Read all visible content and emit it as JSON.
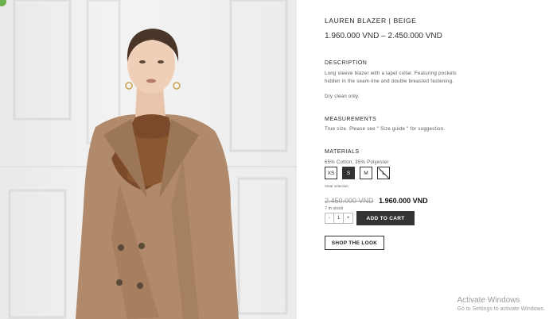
{
  "product": {
    "title": "LAUREN BLAZER | BEIGE",
    "price_range": "1.960.000 VND – 2.450.000 VND"
  },
  "description": {
    "heading": "DESCRIPTION",
    "line1": "Long sleeve blazer with a lapel collar. Featuring pockets",
    "line2": "hidden in the seam-line and double breasted fastening.",
    "care": "Dry clean only."
  },
  "measurements": {
    "heading": "MEASUREMENTS",
    "text": "True size. Please see \" Size guide \" for suggestion."
  },
  "materials": {
    "heading": "MATERIALS",
    "text": "65% Cotton, 35% Polyester"
  },
  "sizes": [
    {
      "label": "XS",
      "state": "available"
    },
    {
      "label": "S",
      "state": "selected"
    },
    {
      "label": "M",
      "state": "available"
    },
    {
      "label": "L",
      "state": "unavailable"
    }
  ],
  "clear_selection": "Clear selection",
  "pricing": {
    "old_price": "2.450.000 VND",
    "new_price": "1.960.000 VND",
    "stock": "7 in stock"
  },
  "quantity": {
    "minus": "-",
    "value": "1",
    "plus": "+"
  },
  "buttons": {
    "add_to_cart": "ADD TO CART",
    "shop_the_look": "SHOP THE LOOK"
  },
  "watermark": {
    "line1": "Activate Windows",
    "line2": "Go to Settings to activate Windows."
  },
  "colors": {
    "dark": "#333333",
    "blazer": "#b08a6a",
    "scarf": "#7a4a2a"
  }
}
